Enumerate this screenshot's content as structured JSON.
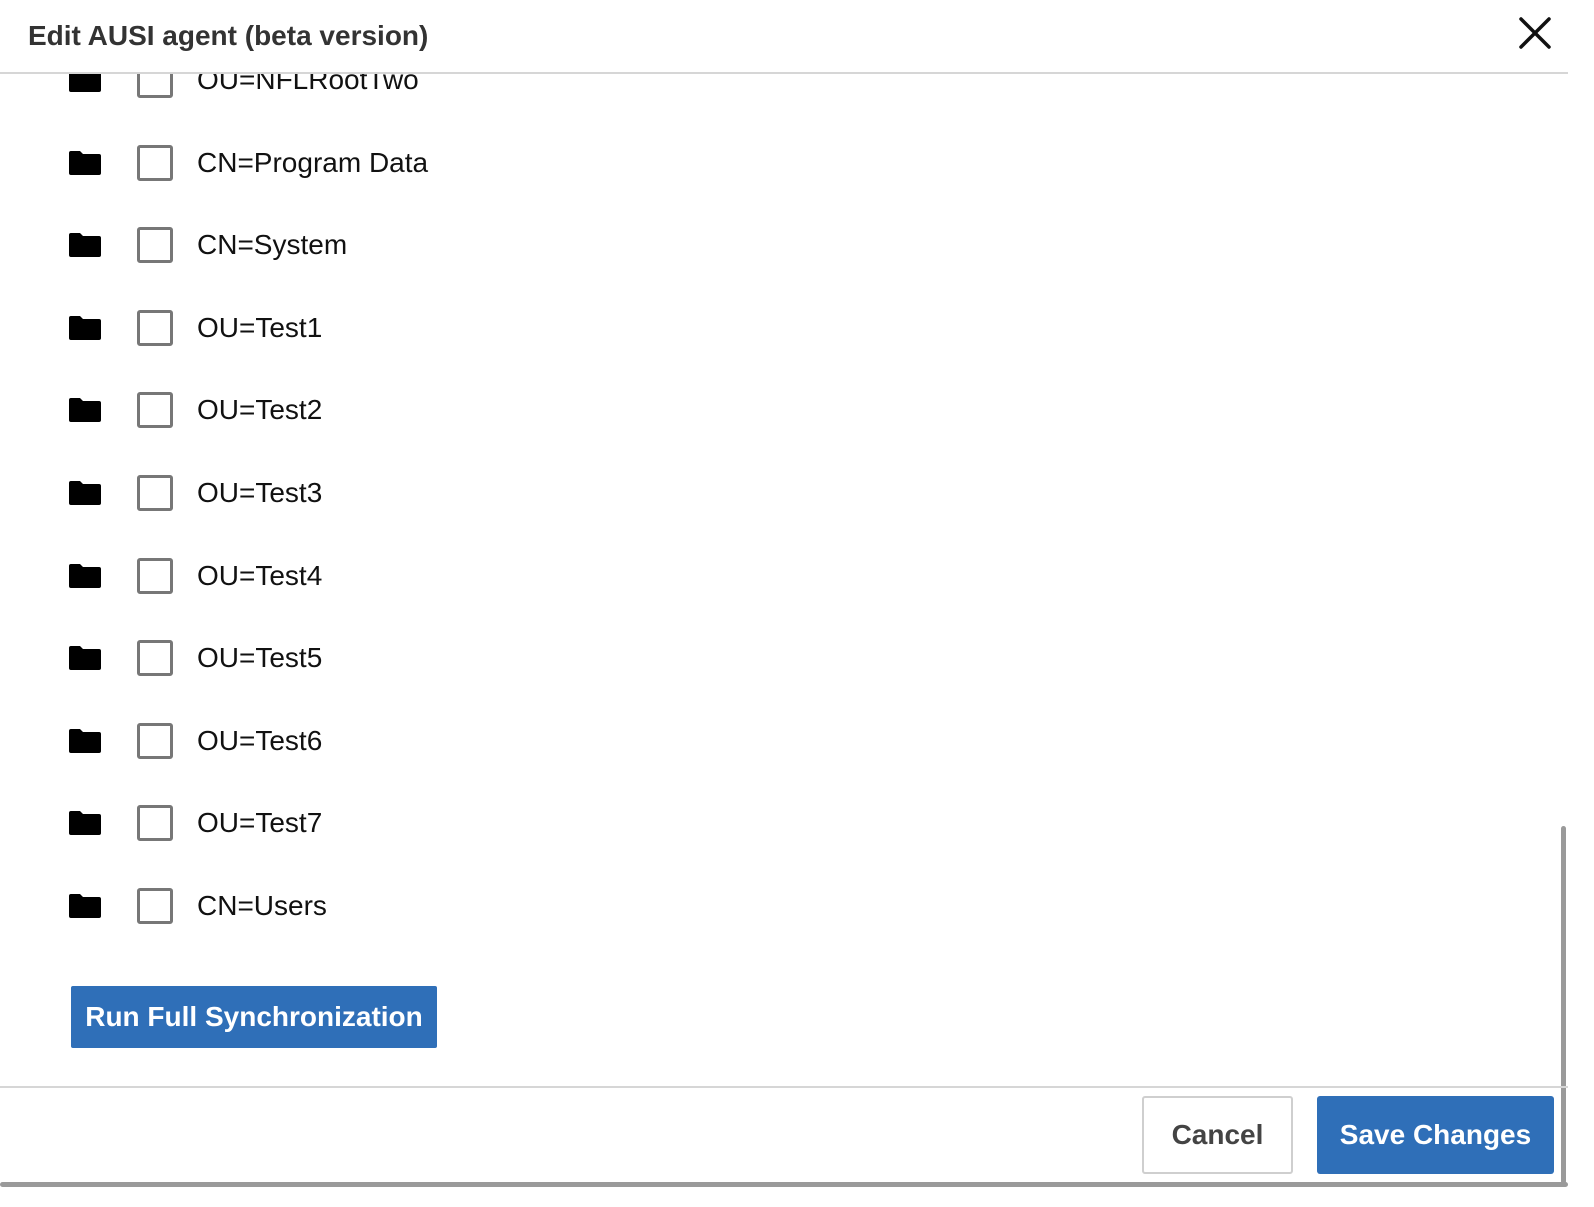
{
  "dialog": {
    "title": "Edit AUSI agent (beta version)",
    "close_icon": "close-icon"
  },
  "tree": {
    "items": [
      {
        "label": "OU=NFLRootTwo",
        "checked": false,
        "icon": "folder-icon"
      },
      {
        "label": "CN=Program Data",
        "checked": false,
        "icon": "folder-icon"
      },
      {
        "label": "CN=System",
        "checked": false,
        "icon": "folder-icon"
      },
      {
        "label": "OU=Test1",
        "checked": false,
        "icon": "folder-icon"
      },
      {
        "label": "OU=Test2",
        "checked": false,
        "icon": "folder-icon"
      },
      {
        "label": "OU=Test3",
        "checked": false,
        "icon": "folder-icon"
      },
      {
        "label": "OU=Test4",
        "checked": false,
        "icon": "folder-icon"
      },
      {
        "label": "OU=Test5",
        "checked": false,
        "icon": "folder-icon"
      },
      {
        "label": "OU=Test6",
        "checked": false,
        "icon": "folder-icon"
      },
      {
        "label": "OU=Test7",
        "checked": false,
        "icon": "folder-icon"
      },
      {
        "label": "CN=Users",
        "checked": false,
        "icon": "folder-icon"
      }
    ]
  },
  "actions": {
    "sync_label": "Run Full Synchronization"
  },
  "footer": {
    "cancel_label": "Cancel",
    "save_label": "Save Changes"
  },
  "colors": {
    "primary": "#2f6fb8",
    "checkbox_border": "#777777",
    "divider": "#d6d6d6"
  }
}
